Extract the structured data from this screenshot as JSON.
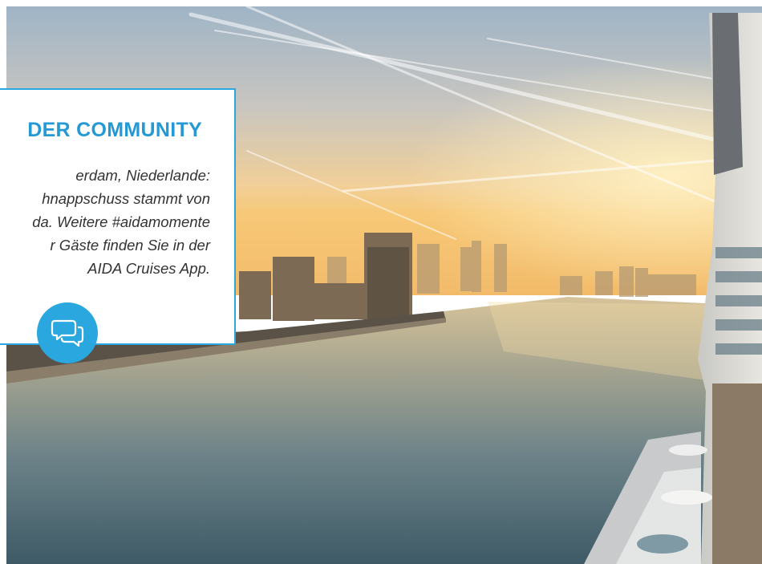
{
  "card": {
    "title": "DER COMMUNITY",
    "lines": [
      "erdam, Niederlande:",
      "hnappschuss stammt von",
      "da. Weitere #aidamomente",
      "r Gäste finden Sie in der",
      "AIDA Cruises App."
    ]
  },
  "icons": {
    "badge": "speech-bubbles-icon"
  },
  "colors": {
    "accent": "#2aa7df",
    "title": "#2499d4"
  }
}
